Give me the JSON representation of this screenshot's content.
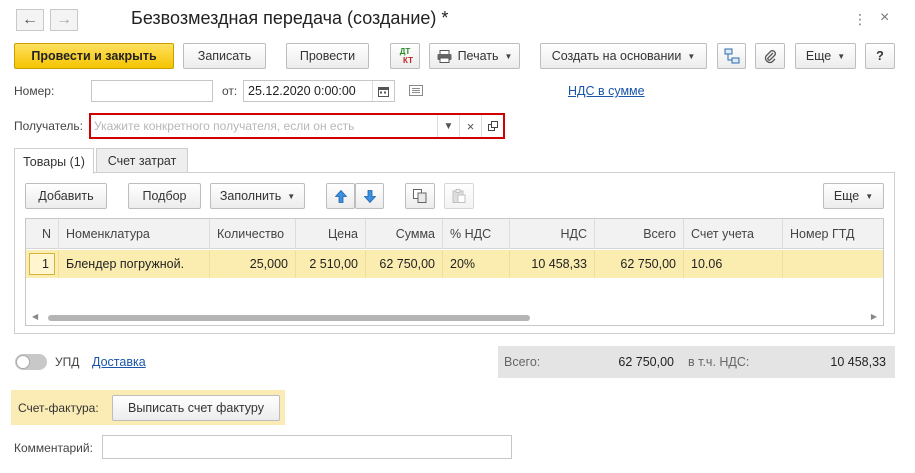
{
  "window": {
    "title": "Безвозмездная передача (создание) *",
    "back_icon": "arrow-left-icon",
    "forward_icon": "arrow-right-icon",
    "menu_glyph": "⋮",
    "close_glyph": "×"
  },
  "toolbar": {
    "post_close": "Провести и закрыть",
    "save": "Записать",
    "post": "Провести",
    "dt_kt_top": "ДТ",
    "dt_kt_bottom": "КТ",
    "print": "Печать",
    "create_based": "Создать на основании",
    "more": "Еще",
    "help": "?"
  },
  "form": {
    "number_label": "Номер:",
    "number_value": "",
    "date_label": "от:",
    "date_value": "25.12.2020  0:00:00",
    "vat_link": "НДС в сумме",
    "recipient_label": "Получатель:",
    "recipient_placeholder": "Укажите конкретного получателя, если он есть"
  },
  "tabs": [
    {
      "label": "Товары (1)",
      "active": true
    },
    {
      "label": "Счет затрат",
      "active": false
    }
  ],
  "table_toolbar": {
    "add": "Добавить",
    "pick": "Подбор",
    "fill": "Заполнить",
    "more": "Еще"
  },
  "table": {
    "columns": [
      "N",
      "Номенклатура",
      "Количество",
      "Цена",
      "Сумма",
      "% НДС",
      "НДС",
      "Всего",
      "Счет учета",
      "Номер ГТД"
    ],
    "rows": [
      {
        "n": "1",
        "item": "Блендер погружной.",
        "qty": "25,000",
        "price": "2 510,00",
        "sum": "62 750,00",
        "vat_rate": "20%",
        "vat": "10 458,33",
        "total": "62 750,00",
        "account": "10.06",
        "gtd": ""
      }
    ]
  },
  "footer": {
    "upd_label": "УПД",
    "delivery_link": "Доставка",
    "total_label": "Всего:",
    "total_value": "62 750,00",
    "vat_label": "в т.ч. НДС:",
    "vat_value": "10 458,33",
    "invoice_label": "Счет-фактура:",
    "invoice_button": "Выписать счет фактуру",
    "comment_label": "Комментарий:",
    "comment_value": ""
  },
  "colors": {
    "primary_button": "#f5c400",
    "selected_row": "#fbedb0",
    "highlight_border": "#d00000",
    "link": "#1a55a8"
  }
}
